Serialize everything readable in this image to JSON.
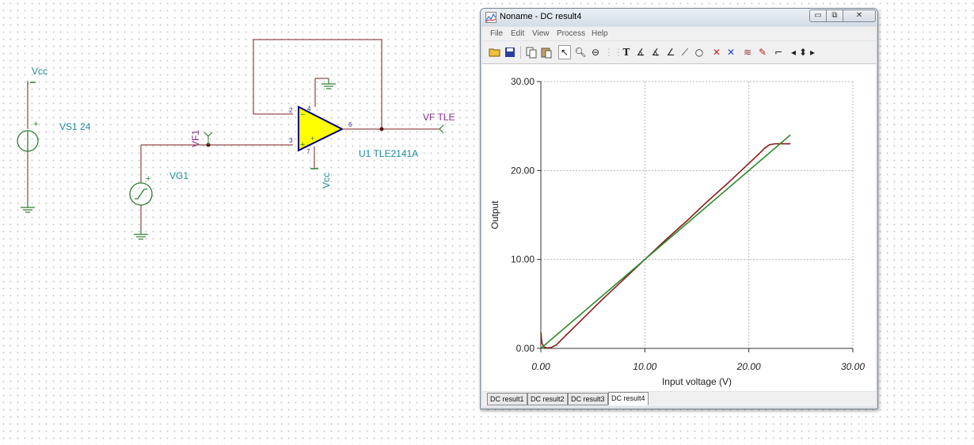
{
  "schematic": {
    "vcc_label": "Vcc",
    "vs1_label": "VS1 24",
    "vg1_label": "VG1",
    "vf1_label": "VF1",
    "opamp_label": "U1 TLE2141A",
    "vf_tle_label": "VF TLE",
    "opamp_vcc_label": "Vcc",
    "pin2": "2",
    "pin3": "3",
    "pin4": "4",
    "pin6": "6",
    "pin7": "7",
    "plus": "+",
    "minus": "−",
    "colors": {
      "wire": "#7a1f1f",
      "ground": "#2e7d32",
      "label": "#1a8a9a",
      "probe": "#8a2b8a",
      "opamp_fill": "#ffff00",
      "opamp_stroke": "#00008b"
    }
  },
  "window": {
    "title": "Noname - DC result4",
    "menu": [
      "File",
      "Edit",
      "View",
      "Process",
      "Help"
    ],
    "toolbar_icons": [
      "open-icon",
      "save-icon",
      "copy-icon",
      "paste-icon",
      "pointer-icon",
      "zoom-in-icon",
      "zoom-100-icon",
      "grid-icon",
      "text-icon",
      "cursor-a-icon",
      "cursor-b-icon",
      "formula-icon",
      "line-icon",
      "circle-icon",
      "marker-a-icon",
      "marker-b-icon",
      "curves-icon",
      "pen-icon",
      "corner-icon",
      "arrow-left-icon",
      "arrows-updown-icon",
      "arrow-right-icon"
    ],
    "tabs": [
      "DC result1",
      "DC result2",
      "DC result3",
      "DC result4"
    ],
    "active_tab": 3
  },
  "chart_data": {
    "type": "line",
    "title": "",
    "xlabel": "Input voltage (V)",
    "ylabel": "Output",
    "xlim": [
      0,
      30
    ],
    "ylim": [
      0,
      30
    ],
    "x_ticks": [
      "0.00",
      "10.00",
      "20.00",
      "30.00"
    ],
    "y_ticks": [
      "0.00",
      "10.00",
      "20.00",
      "30.00"
    ],
    "grid": true,
    "series": [
      {
        "color": "#8b1a1a",
        "x": [
          0,
          0.1,
          0.3,
          0.6,
          1.0,
          1.5,
          2.0,
          4.0,
          6.0,
          8.0,
          10.0,
          12.0,
          14.0,
          16.0,
          18.0,
          20.0,
          21.0,
          21.5,
          22.0,
          22.5,
          23.0,
          24.0
        ],
        "y": [
          1.8,
          0.6,
          0.15,
          0.05,
          0.1,
          0.4,
          1.0,
          3.3,
          5.6,
          7.8,
          10.0,
          12.2,
          14.3,
          16.5,
          18.6,
          20.8,
          21.9,
          22.5,
          22.9,
          23.0,
          23.0,
          23.0
        ]
      },
      {
        "color": "#2e8b2e",
        "x": [
          0,
          24.0
        ],
        "y": [
          0,
          24.0
        ]
      }
    ]
  }
}
